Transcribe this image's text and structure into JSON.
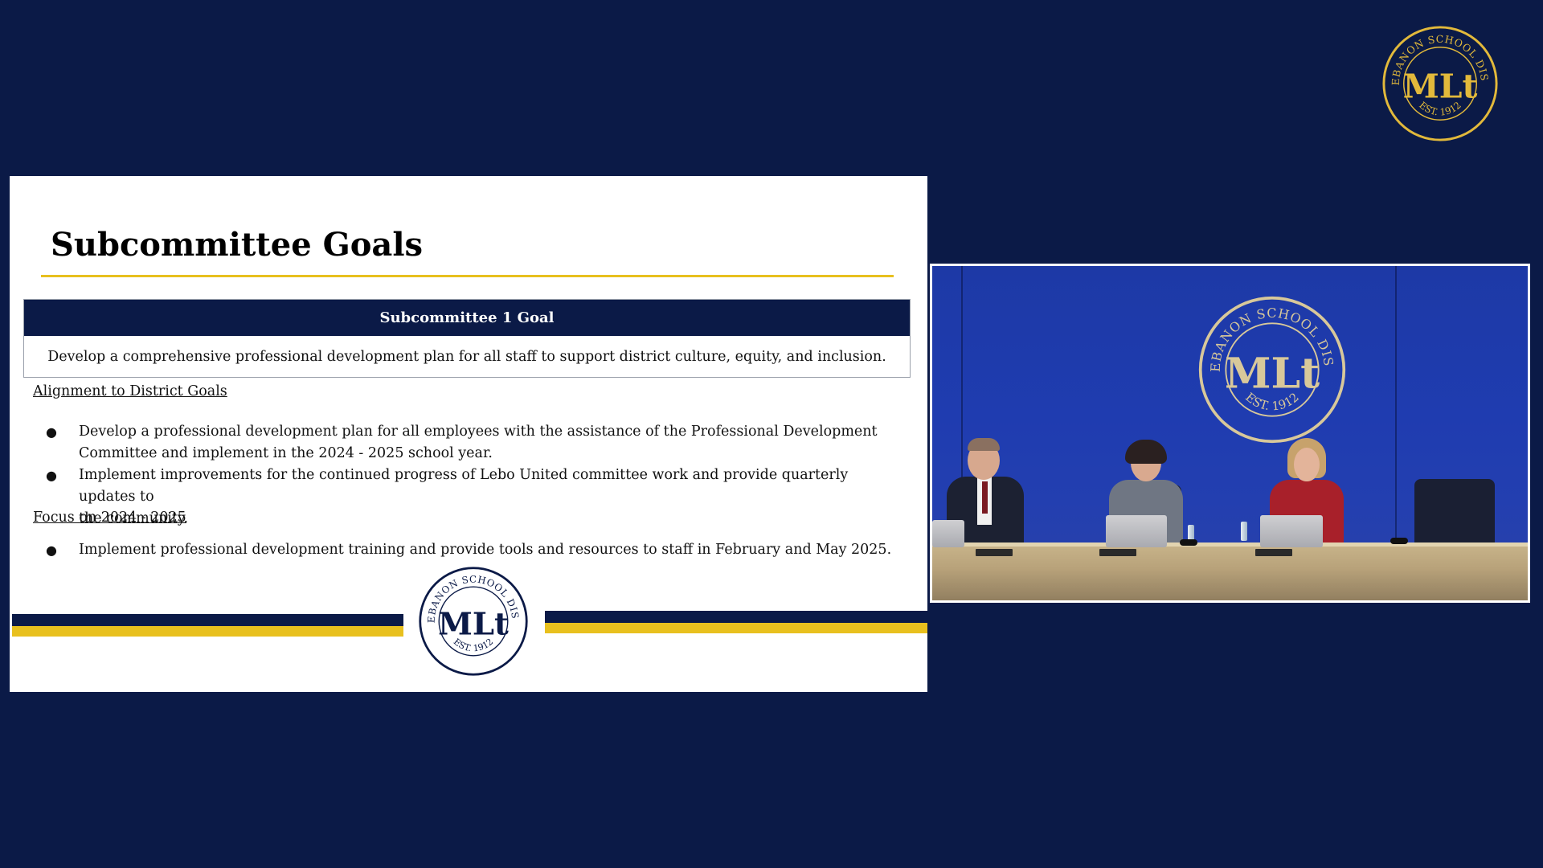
{
  "slide": {
    "title": "Subcommittee Goals",
    "goal_header": "Subcommittee 1 Goal",
    "goal_text": "Develop a comprehensive professional development plan for all staff to support district culture, equity,  and inclusion.",
    "alignment_heading": "Alignment to District Goals",
    "alignment_items": [
      {
        "line1": "Develop a professional development plan for all employees with the assistance of the Professional Development",
        "line2": "Committee and implement in the 2024 - 2025 school year."
      },
      {
        "line1": "Implement improvements for the continued progress of Lebo United committee work and provide quarterly updates to",
        "line2": "the community."
      }
    ],
    "focus_heading": "Focus on 2024 - 2025",
    "focus_items": [
      "Implement professional development training and provide tools and resources to staff in February and May 2025."
    ],
    "bullet_glyph": "●"
  },
  "logo": {
    "seal_text_top": "MT. LEBANON SCHOOL DISTRICT",
    "seal_text_bottom": "EST. 1912",
    "monogram": "MLt"
  },
  "colors": {
    "background_navy": "#0b1a47",
    "accent_gold": "#e8c01e",
    "wall_blue": "#1f3cb0",
    "white": "#ffffff"
  }
}
